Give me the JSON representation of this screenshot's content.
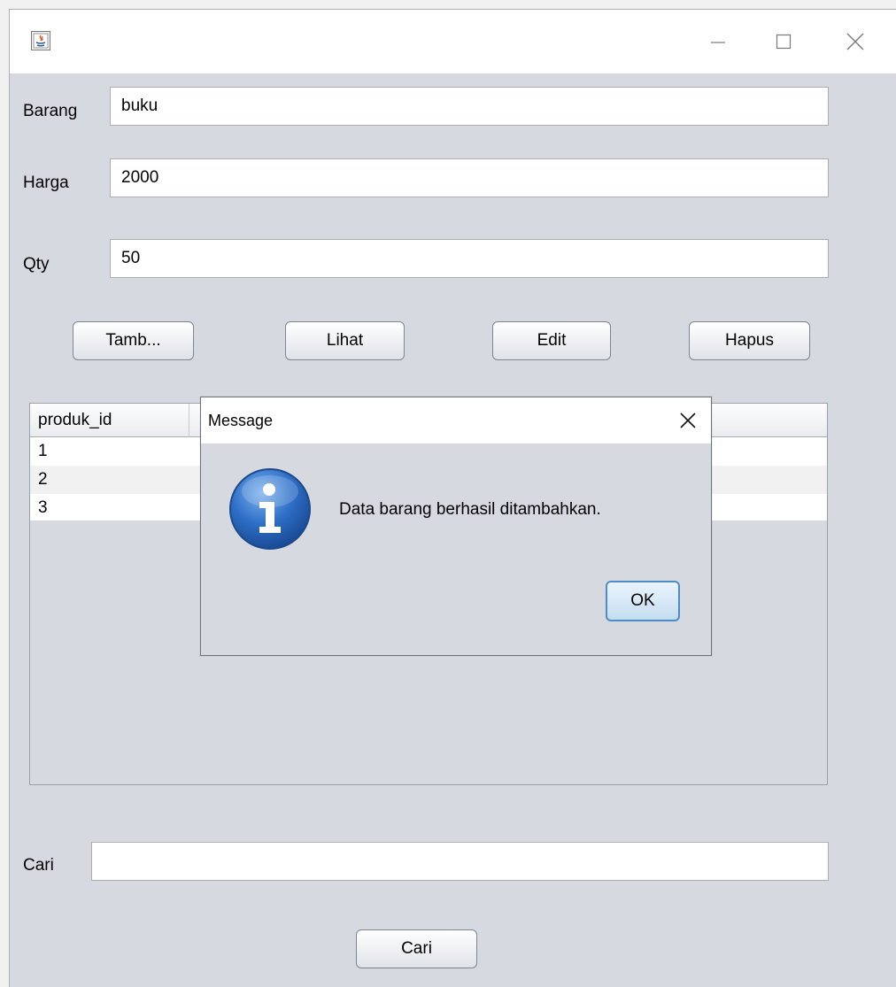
{
  "window": {
    "title": "",
    "controls": {
      "minimize": "minimize-icon",
      "maximize": "maximize-icon",
      "close": "close-icon"
    }
  },
  "form": {
    "barang": {
      "label": "Barang",
      "value": "buku"
    },
    "harga": {
      "label": "Harga",
      "value": "2000"
    },
    "qty": {
      "label": "Qty",
      "value": "50"
    }
  },
  "buttons": {
    "tambah": "Tamb...",
    "lihat": "Lihat",
    "edit": "Edit",
    "hapus": "Hapus"
  },
  "table": {
    "columns": [
      "produk_id"
    ],
    "rows": [
      [
        "1"
      ],
      [
        "2"
      ],
      [
        "3"
      ]
    ]
  },
  "search": {
    "label": "Cari",
    "value": "",
    "button": "Cari"
  },
  "dialog": {
    "title": "Message",
    "icon": "info-icon",
    "message": "Data barang berhasil ditambahkan.",
    "ok_label": "OK"
  },
  "colors": {
    "window_bg": "#d6d9df",
    "titlebar_bg": "#ffffff",
    "row_alt": "#f1f1f1",
    "ok_border": "#4d8cc8"
  }
}
